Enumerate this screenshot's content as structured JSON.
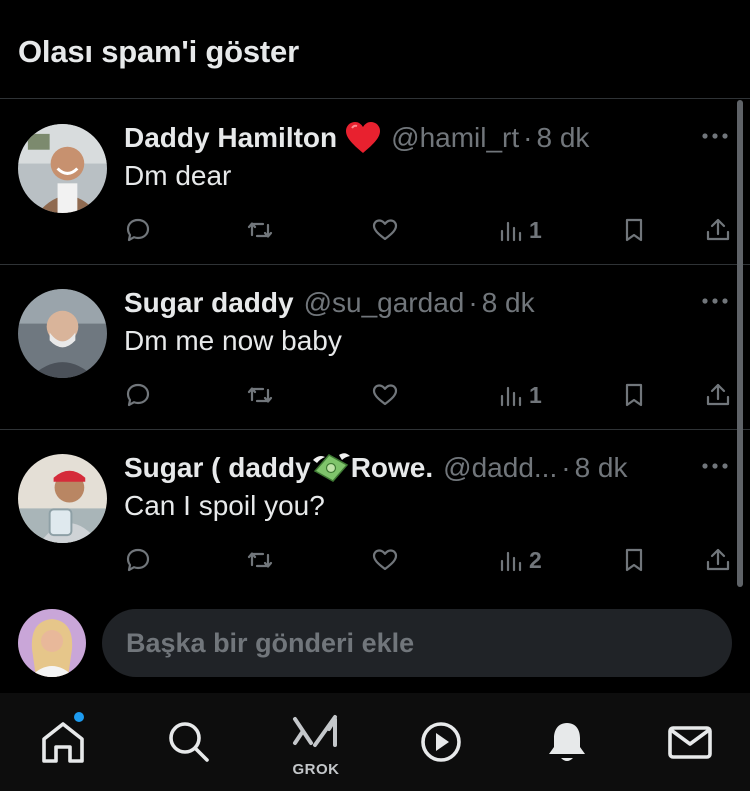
{
  "header": {
    "title": "Olası spam'i göster"
  },
  "posts": [
    {
      "display_name": "Daddy Hamilton",
      "name_emoji": "heart-emoji",
      "handle": "@hamil_rt",
      "separator": "·",
      "time": "8 dk",
      "text": "Dm dear",
      "views": "1"
    },
    {
      "display_name": "Sugar daddy",
      "handle": "@su_gardad",
      "separator": "·",
      "time": "8 dk",
      "text": "Dm me now baby",
      "views": "1"
    },
    {
      "display_name_part1": "Sugar ( daddy",
      "name_emoji": "money-with-wings-emoji",
      "display_name_part2": "Rowe.",
      "handle": "@dadd...",
      "separator": "·",
      "time": "8 dk",
      "text": "Can I spoil you?",
      "views": "2"
    }
  ],
  "compose": {
    "placeholder": "Başka bir gönderi ekle"
  },
  "tabbar": {
    "items": [
      "home-icon",
      "search-icon",
      "grok-icon",
      "video-icon",
      "notifications-icon",
      "messages-icon"
    ],
    "grok_label": "GROK"
  },
  "colors": {
    "background": "#000000",
    "text": "#e7e9ea",
    "muted": "#71767b",
    "accent": "#1d9bf0",
    "divider": "#2f3336"
  }
}
